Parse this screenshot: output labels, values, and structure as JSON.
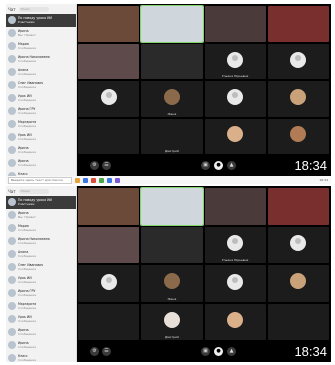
{
  "screenshot_top": {
    "sidebar": {
      "title": "Чат",
      "search_placeholder": "Поиск",
      "chats": [
        {
          "name": "По поводу урока ИИ",
          "msg": "Участники",
          "time": ""
        },
        {
          "name": "Ирина",
          "msg": "Вы: Привет",
          "time": ""
        },
        {
          "name": "Мария",
          "msg": "Сообщение",
          "time": ""
        },
        {
          "name": "Ирина Николаевна",
          "msg": "Сообщение",
          "time": ""
        },
        {
          "name": "Алина",
          "msg": "Сообщение",
          "time": ""
        },
        {
          "name": "Олег Иванович",
          "msg": "Сообщение",
          "time": ""
        },
        {
          "name": "Урок ИИ",
          "msg": "Сообщение",
          "time": ""
        },
        {
          "name": "Ирина ГРУ",
          "msg": "Сообщение",
          "time": ""
        },
        {
          "name": "Маргарита",
          "msg": "Сообщение",
          "time": ""
        },
        {
          "name": "Урок ИИ",
          "msg": "Сообщение",
          "time": ""
        },
        {
          "name": "Ирина",
          "msg": "Сообщение",
          "time": ""
        },
        {
          "name": "Ирина",
          "msg": "Сообщение",
          "time": ""
        },
        {
          "name": "Класс",
          "msg": "Сообщение",
          "time": ""
        }
      ]
    },
    "tiles": [
      {
        "label": "",
        "type": "cam",
        "color": "#6b4a3a",
        "speaking": false
      },
      {
        "label": "",
        "type": "cam",
        "color": "#cfd7dd",
        "speaking": true
      },
      {
        "label": "",
        "type": "cam",
        "color": "#4a3a3a",
        "speaking": false
      },
      {
        "label": "",
        "type": "cam",
        "color": "#7a2f2f",
        "speaking": false
      },
      {
        "label": "",
        "type": "cam",
        "color": "#5e4a4a",
        "speaking": false
      },
      {
        "label": "",
        "type": "cam",
        "color": "#2a2a2a",
        "speaking": false
      },
      {
        "label": "Ульяна Юрьевна",
        "type": "avatar",
        "color": "",
        "speaking": false
      },
      {
        "label": "",
        "type": "avatar",
        "color": "",
        "speaking": false
      },
      {
        "label": "",
        "type": "avatar",
        "color": "",
        "speaking": false
      },
      {
        "label": "Женя",
        "type": "photo",
        "color": "#8a6a4a",
        "speaking": false
      },
      {
        "label": "",
        "type": "avatar",
        "color": "",
        "speaking": false
      },
      {
        "label": "",
        "type": "photo",
        "color": "#c9a27a",
        "speaking": false
      },
      {
        "label": "",
        "type": "empty",
        "color": "",
        "speaking": false
      },
      {
        "label": "Дмитрий",
        "type": "empty",
        "color": "",
        "speaking": false
      },
      {
        "label": "",
        "type": "photo",
        "color": "#d9b08a",
        "speaking": false
      },
      {
        "label": "",
        "type": "photo",
        "color": "#b07b55",
        "speaking": false
      }
    ],
    "clock": "18:34"
  },
  "taskbar": {
    "search_placeholder": "Введите здесь текст для поиска",
    "icon_colors": [
      "#e9a23b",
      "#3b78e7",
      "#d94f3b",
      "#4aa84a",
      "#3b78e7",
      "#7a5ad9"
    ],
    "tray": "18:34"
  },
  "screenshot_bottom": {
    "badge": "",
    "sidebar": {
      "title": "Чат",
      "search_placeholder": "Поиск",
      "chats": [
        {
          "name": "По поводу урока ИИ",
          "msg": "Участники",
          "time": ""
        },
        {
          "name": "Ирина",
          "msg": "Вы: Привет",
          "time": ""
        },
        {
          "name": "Мария",
          "msg": "Сообщение",
          "time": ""
        },
        {
          "name": "Ирина Николаевна",
          "msg": "Сообщение",
          "time": ""
        },
        {
          "name": "Алина",
          "msg": "Сообщение",
          "time": ""
        },
        {
          "name": "Олег Иванович",
          "msg": "Сообщение",
          "time": ""
        },
        {
          "name": "Урок ИИ",
          "msg": "Сообщение",
          "time": ""
        },
        {
          "name": "Ирина ГРУ",
          "msg": "Сообщение",
          "time": ""
        },
        {
          "name": "Маргарита",
          "msg": "Сообщение",
          "time": ""
        },
        {
          "name": "Урок ИИ",
          "msg": "Сообщение",
          "time": ""
        },
        {
          "name": "Ирина",
          "msg": "Сообщение",
          "time": ""
        },
        {
          "name": "Ирина",
          "msg": "Сообщение",
          "time": ""
        },
        {
          "name": "Класс",
          "msg": "Сообщение",
          "time": ""
        }
      ]
    },
    "tiles": [
      {
        "label": "",
        "type": "cam",
        "color": "#6b4a3a",
        "speaking": false
      },
      {
        "label": "",
        "type": "cam",
        "color": "#cfd7dd",
        "speaking": true
      },
      {
        "label": "",
        "type": "cam",
        "color": "#4a3a3a",
        "speaking": false
      },
      {
        "label": "",
        "type": "cam",
        "color": "#7a2f2f",
        "speaking": false
      },
      {
        "label": "",
        "type": "cam",
        "color": "#5e4a4a",
        "speaking": false
      },
      {
        "label": "",
        "type": "cam",
        "color": "#2a2a2a",
        "speaking": false
      },
      {
        "label": "Ульяна Юрьевна",
        "type": "avatar",
        "color": "",
        "speaking": false
      },
      {
        "label": "",
        "type": "avatar",
        "color": "",
        "speaking": false
      },
      {
        "label": "",
        "type": "avatar",
        "color": "",
        "speaking": false
      },
      {
        "label": "Женя",
        "type": "photo",
        "color": "#8a6a4a",
        "speaking": false
      },
      {
        "label": "",
        "type": "avatar",
        "color": "",
        "speaking": false
      },
      {
        "label": "",
        "type": "photo",
        "color": "#c9a27a",
        "speaking": false
      },
      {
        "label": "",
        "type": "empty",
        "color": "",
        "speaking": false
      },
      {
        "label": "Дмитрий",
        "type": "photo",
        "color": "#e8e0d8",
        "speaking": false
      },
      {
        "label": "",
        "type": "photo",
        "color": "#d9b08a",
        "speaking": false
      },
      {
        "label": "",
        "type": "empty",
        "color": "",
        "speaking": false
      }
    ],
    "clock": "18:34"
  }
}
